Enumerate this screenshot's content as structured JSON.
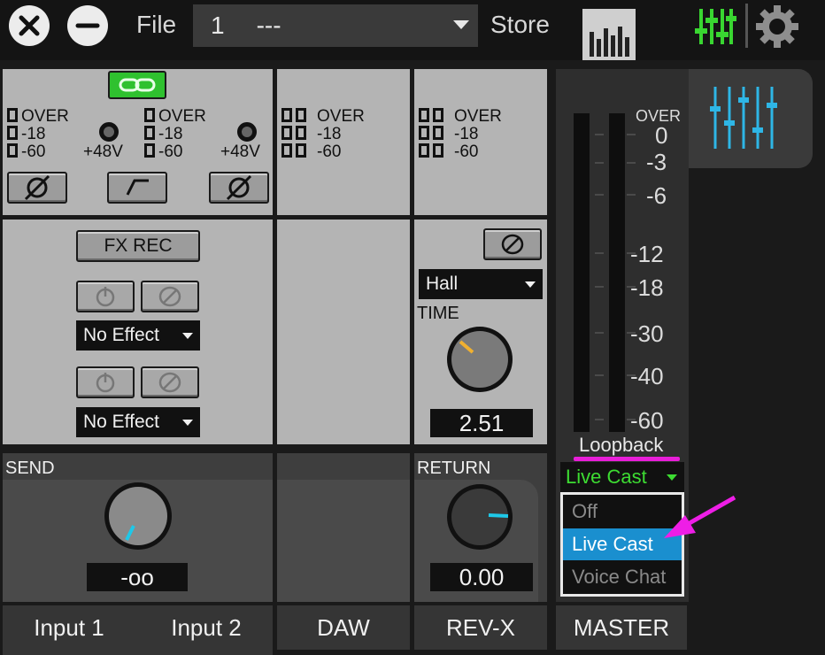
{
  "topbar": {
    "close_icon": "close-icon",
    "minimize_icon": "minimize-icon",
    "file_label": "File",
    "file_number": "1",
    "file_name": "---",
    "store_label": "Store",
    "meter_view_icon": "meter-view-icon",
    "mixer_icon": "mixer-icon",
    "settings_icon": "gear-icon",
    "mixer_color": "#39d631"
  },
  "input_section": {
    "link_icon": "link-icon",
    "ch1_meter": {
      "over": "OVER",
      "m18": "-18",
      "m60": "-60",
      "phantom": "+48V"
    },
    "ch2_meter": {
      "over": "OVER",
      "m18": "-18",
      "m60": "-60",
      "phantom": "+48V"
    },
    "fx_rec_label": "FX REC",
    "effect1": "No Effect",
    "effect2": "No Effect",
    "send_label": "SEND",
    "send_value": "-oo",
    "send_knob_angle_deg": 215,
    "input1_label": "Input 1",
    "input2_label": "Input 2"
  },
  "daw_section": {
    "meter": {
      "over": "OVER",
      "m18": "-18",
      "m60": "-60"
    },
    "label": "DAW"
  },
  "revx_section": {
    "meter": {
      "over": "OVER",
      "m18": "-18",
      "m60": "-60"
    },
    "type": "Hall",
    "time_label": "TIME",
    "time_value": "2.51",
    "time_knob_color": "#f0b030",
    "return_label": "RETURN",
    "return_value": "0.00",
    "return_knob_color": "#1ec8e8",
    "label": "REV-X"
  },
  "master_section": {
    "scale": [
      "OVER",
      "0",
      "-3",
      "-6",
      "-12",
      "-18",
      "-30",
      "-40",
      "-60"
    ],
    "loopback_label": "Loopback",
    "loopback_value": "Live Cast",
    "loopback_value_color": "#3ddc32",
    "menu_options": [
      "Off",
      "Live Cast",
      "Voice Chat"
    ],
    "menu_selected": "Live Cast",
    "menu_highlight_color": "#1a8fcf",
    "label": "MASTER",
    "mixer_tab_icon": "mixer-tab-icon",
    "accent_color": "#2eb6e6"
  },
  "annotations": {
    "underline_color": "#e81ed8",
    "arrow_color": "#ee1ee6"
  }
}
